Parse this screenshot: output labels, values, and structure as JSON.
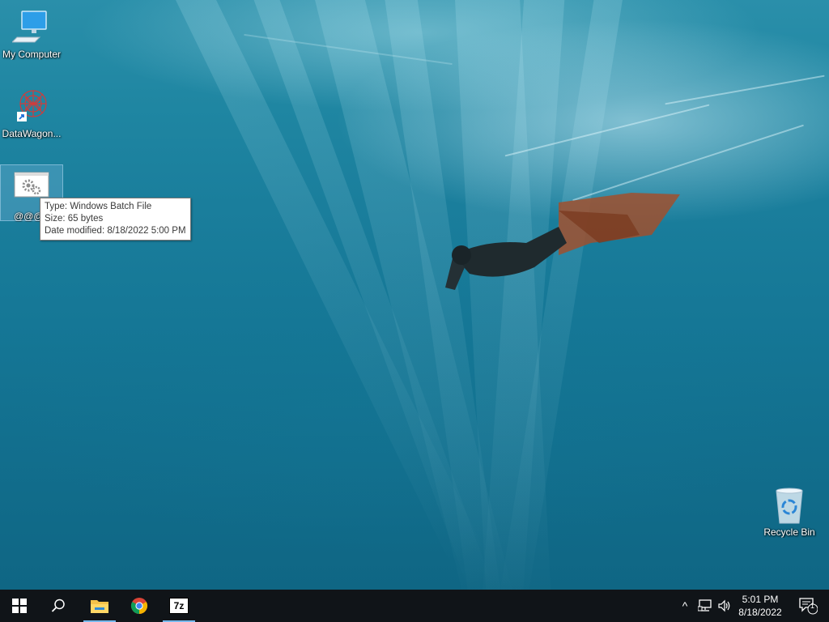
{
  "desktop": {
    "icons": [
      {
        "label": "My Computer",
        "icon": "computer-icon"
      },
      {
        "label": "DataWagon...",
        "icon": "datawagon-app-icon"
      },
      {
        "label": "@@@",
        "icon": "batch-file-gear-icon"
      },
      {
        "label": "Recycle Bin",
        "icon": "recycle-bin-icon"
      }
    ],
    "tooltip": {
      "type": "Type: Windows Batch File",
      "size": "Size: 65 bytes",
      "date": "Date modified: 8/18/2022 5:00 PM"
    }
  },
  "taskbar": {
    "pinned": [
      {
        "icon": "windows-start-icon"
      },
      {
        "icon": "search-icon"
      },
      {
        "icon": "file-explorer-icon"
      },
      {
        "icon": "chrome-icon"
      },
      {
        "icon": "7zip-icon",
        "label": "7z"
      }
    ],
    "tray": {
      "chevron": "^",
      "time": "5:01 PM",
      "date": "8/18/2022",
      "notification_count": "1"
    },
    "accent_color": "#76b9ed",
    "background_color": "#101418"
  }
}
